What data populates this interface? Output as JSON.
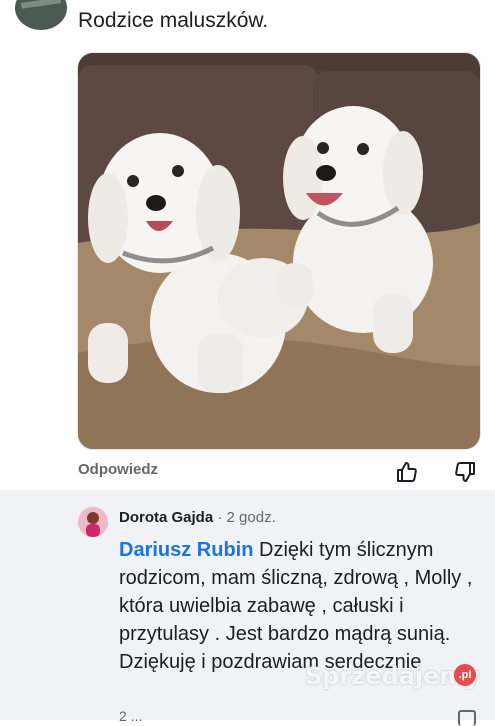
{
  "top_comment": {
    "text": "Rodzice maluszków.",
    "reply_label": "Odpowiedz",
    "like_icon": "thumbs-up-icon",
    "dislike_icon": "thumbs-down-icon"
  },
  "reply": {
    "author": "Dorota Gajda",
    "separator": " · ",
    "time": "2 godz.",
    "mention": "Dariusz Rubin",
    "body": "Dzięki tym ślicznym rodzicom, mam śliczną, zdrową , Molly , która uwielbia zabawę , całuski i przytulasy . Jest bardzo mądrą sunią. Dziękuję i pozdrawiam serdecznie",
    "next_line_partial": "2 ..."
  },
  "watermark": {
    "text": "Sprzedajemy",
    "suffix": ".pl"
  },
  "colors": {
    "mention": "#1b74e4",
    "reply_background": "#f0f2f5",
    "muted_text": "#65676b",
    "watermark_badge": "#e84b4b"
  }
}
